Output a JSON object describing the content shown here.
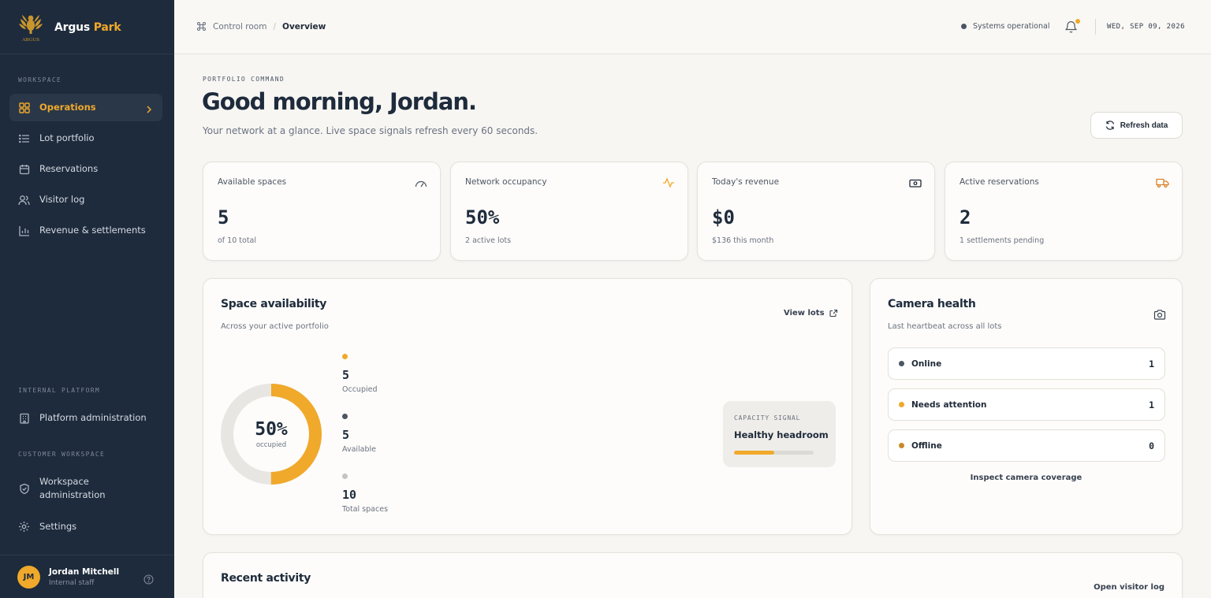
{
  "app": {
    "brand_main": "Argus",
    "brand_accent": "Park",
    "logo_text": "ARGUS"
  },
  "sidebar": {
    "sections": {
      "workspace": "WORKSPACE",
      "internal_platform": "INTERNAL PLATFORM",
      "customer_workspace": "CUSTOMER WORKSPACE"
    },
    "items": [
      {
        "label": "Operations",
        "icon": "grid-icon",
        "active": true
      },
      {
        "label": "Lot portfolio",
        "icon": "list-icon"
      },
      {
        "label": "Reservations",
        "icon": "calendar-icon"
      },
      {
        "label": "Visitor log",
        "icon": "users-icon"
      },
      {
        "label": "Revenue & settlements",
        "icon": "bar-chart-icon"
      },
      {
        "label": "Platform administration",
        "icon": "building-icon"
      },
      {
        "label": "Workspace administration",
        "icon": "shield-icon"
      },
      {
        "label": "Settings",
        "icon": "gear-icon"
      }
    ],
    "user": {
      "initials": "JM",
      "name": "Jordan Mitchell",
      "role": "Internal staff"
    }
  },
  "topbar": {
    "breadcrumb": [
      "Control room",
      "Overview"
    ],
    "status": "Systems operational",
    "date": "WED, SEP 09, 2026"
  },
  "header": {
    "eyebrow": "PORTFOLIO COMMAND",
    "greeting": "Good morning, Jordan.",
    "subtitle": "Your network at a glance. Live space signals refresh every 60 seconds.",
    "refresh_label": "Refresh data"
  },
  "stats": [
    {
      "label": "Available spaces",
      "value": "5",
      "sub": "of 10 total",
      "icon": "gauge-icon"
    },
    {
      "label": "Network occupancy",
      "value": "50%",
      "sub": "2 active lots",
      "icon": "activity-icon"
    },
    {
      "label": "Today's revenue",
      "value": "$0",
      "sub": "$136 this month",
      "icon": "banknote-icon"
    },
    {
      "label": "Active reservations",
      "value": "2",
      "sub": "1 settlements pending",
      "icon": "truck-icon"
    }
  ],
  "availability": {
    "title": "Space availability",
    "subtitle": "Across your active portfolio",
    "view_link": "View lots",
    "occupied_fraction": 0.5,
    "center_value": "50%",
    "center_label": "occupied",
    "legend": [
      {
        "value": "5",
        "label": "Occupied",
        "color": "#f0a92a"
      },
      {
        "value": "5",
        "label": "Available",
        "color": "#4b5563"
      },
      {
        "value": "10",
        "label": "Total spaces",
        "color": "#c4c4c4"
      }
    ],
    "signal": {
      "eyebrow": "CAPACITY SIGNAL",
      "title": "Healthy headroom",
      "fill_fraction": 0.5
    }
  },
  "camera": {
    "title": "Camera health",
    "subtitle": "Last heartbeat across all lots",
    "rows": [
      {
        "label": "Online",
        "count": "1",
        "color": "#4b5563"
      },
      {
        "label": "Needs attention",
        "count": "1",
        "color": "#f0a92a"
      },
      {
        "label": "Offline",
        "count": "0",
        "color": "#c98a2a"
      }
    ],
    "link": "Inspect camera coverage"
  },
  "recent": {
    "title": "Recent activity",
    "link": "Open visitor log"
  },
  "colors": {
    "accent": "#f0a92a",
    "sidebar_bg": "#1e2b3c",
    "ink": "#1e2b3c",
    "track": "#e8e6e2"
  }
}
